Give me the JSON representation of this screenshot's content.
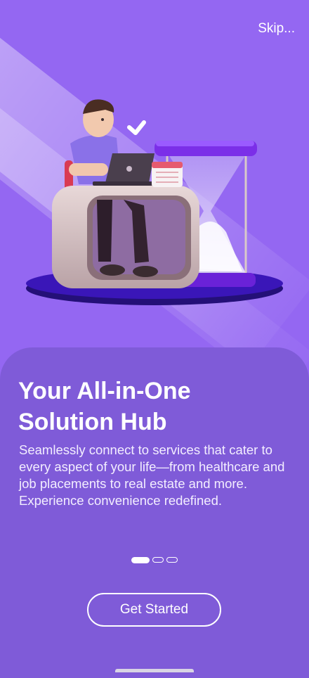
{
  "header": {
    "skip_label": "Skip..."
  },
  "onboarding": {
    "title_line1": "Your All-in-One",
    "title_line2": "Solution Hub",
    "description": "Seamlessly connect to services that cater to every aspect of your life—from healthcare and job placements to real estate and more. Experience convenience redefined.",
    "page_count": 3,
    "active_page": 1
  },
  "actions": {
    "get_started_label": "Get Started"
  },
  "colors": {
    "background": "#9467f2",
    "card": "#7f5bd8",
    "accent_purple": "#7b2fe8",
    "platform": "#3a16b8"
  },
  "illustration": {
    "icons": [
      "person-icon",
      "laptop-icon",
      "calendar-icon",
      "hourglass-icon",
      "checkmark-icon"
    ]
  }
}
